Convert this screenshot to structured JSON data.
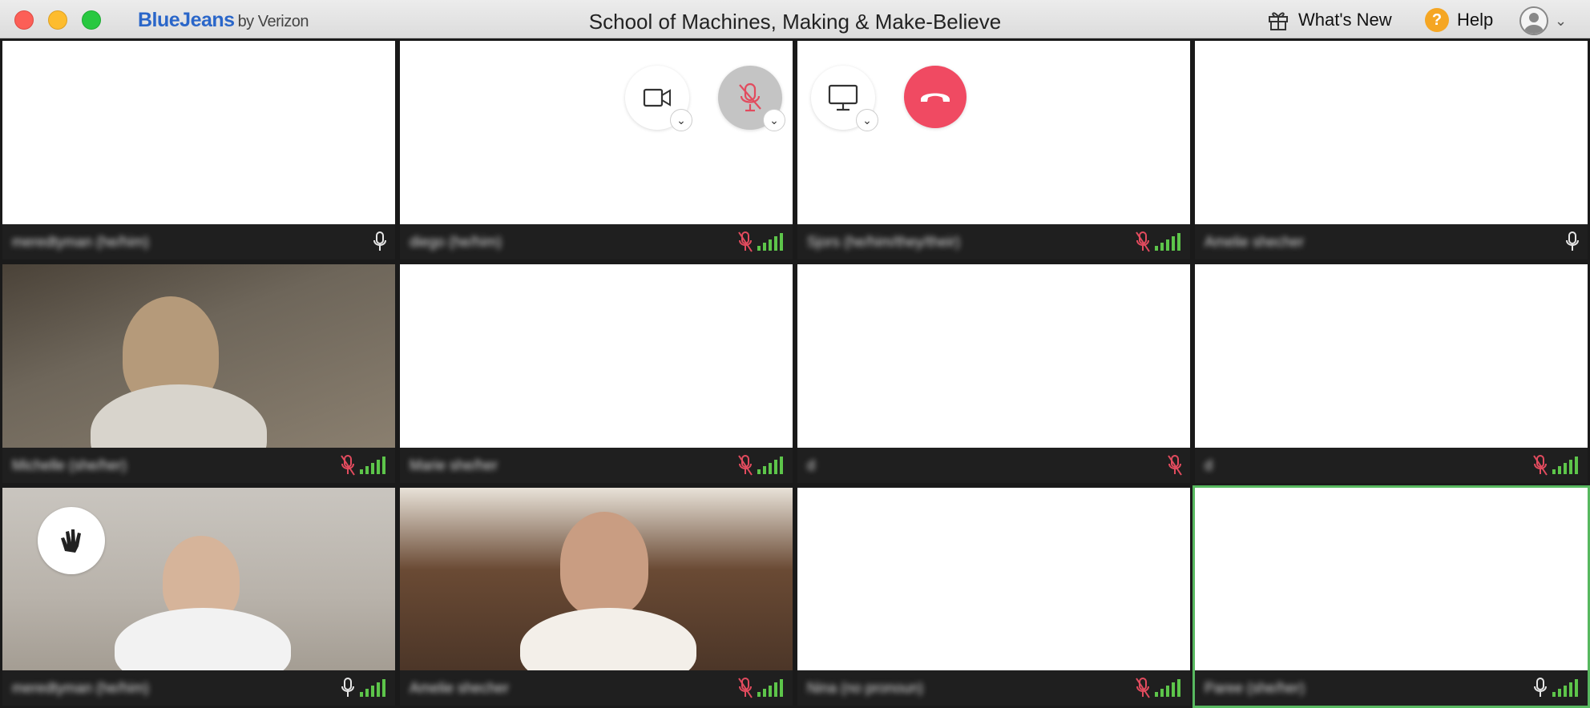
{
  "window": {
    "brand": "BlueJeans",
    "brand_by": "by Verizon",
    "title": "School of Machines, Making & Make-Believe"
  },
  "toolbar": {
    "whats_new": "What's New",
    "help": "Help",
    "help_glyph": "?"
  },
  "controls": [
    {
      "name": "video-toggle",
      "icon": "camera-icon",
      "state": "on"
    },
    {
      "name": "mic-toggle",
      "icon": "mic-muted-icon",
      "state": "muted"
    },
    {
      "name": "screen-share",
      "icon": "monitor-icon",
      "state": "off"
    },
    {
      "name": "hang-up",
      "icon": "phone-hangup-icon",
      "state": "end"
    }
  ],
  "participants": [
    {
      "name": "meredtyman (he/him)",
      "muted": false,
      "signal": false,
      "video": "none"
    },
    {
      "name": "diego (he/him)",
      "muted": true,
      "signal": true,
      "video": "none"
    },
    {
      "name": "Sjors (he/him/they/their)",
      "muted": true,
      "signal": true,
      "video": "none"
    },
    {
      "name": "Amelie shecher",
      "muted": false,
      "signal": false,
      "video": "none"
    },
    {
      "name": "Michelle (she/her)",
      "muted": true,
      "signal": true,
      "video": "camera"
    },
    {
      "name": "Marie she/her",
      "muted": true,
      "signal": true,
      "video": "none"
    },
    {
      "name": "d",
      "muted": true,
      "signal": false,
      "video": "none"
    },
    {
      "name": "d",
      "muted": true,
      "signal": true,
      "video": "none"
    },
    {
      "name": "meredtyman (he/him)",
      "muted": false,
      "signal": true,
      "video": "camera",
      "hand_raised": true
    },
    {
      "name": "Amelie shecher",
      "muted": true,
      "signal": true,
      "video": "camera"
    },
    {
      "name": "Nina (no pronoun)",
      "muted": true,
      "signal": true,
      "video": "none"
    },
    {
      "name": "Paree (she/her)",
      "muted": false,
      "signal": true,
      "video": "none",
      "active_speaker": true
    }
  ],
  "colors": {
    "brand": "#2a66c9",
    "signal": "#5dc54a",
    "muted": "#e24b5e",
    "hangup": "#f04a62",
    "active_border": "#57b85f"
  }
}
